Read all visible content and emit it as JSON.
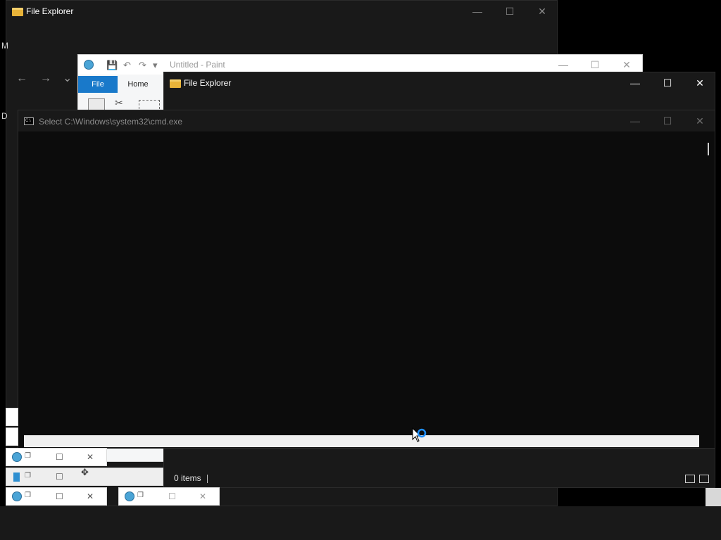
{
  "windows": {
    "file_explorer_back": {
      "title": "File Explorer",
      "controls": {
        "minimize": "—",
        "maximize": "☐",
        "close": "✕"
      },
      "nav": {
        "back": "←",
        "forward": "→",
        "recent": "⌄"
      }
    },
    "paint": {
      "title": "Untitled - Paint",
      "tabs": {
        "file": "File",
        "home": "Home"
      },
      "controls": {
        "minimize": "—",
        "maximize": "☐",
        "close": "✕"
      },
      "qat": {
        "save": "💾",
        "undo": "↶",
        "redo": "↷",
        "customize": "▾"
      }
    },
    "file_explorer_front": {
      "title": "File Explorer",
      "controls": {
        "minimize": "—",
        "maximize": "☐",
        "close": "✕"
      },
      "status": {
        "items": "0 items"
      }
    },
    "cmd": {
      "title": "Select C:\\Windows\\system32\\cmd.exe",
      "controls": {
        "minimize": "—",
        "maximize": "☐",
        "close": "✕"
      },
      "icon_text": "C:\\"
    }
  },
  "edge_fragments": {
    "left_m": "M",
    "left_d": "D"
  },
  "thumbnails": [
    {
      "name": "paint-thumb-1"
    },
    {
      "name": "notepad-thumb"
    },
    {
      "name": "paint-thumb-2"
    },
    {
      "name": "paint-thumb-3"
    }
  ],
  "colors": {
    "accent": "#1979ca",
    "cursor_ring": "#1e90ff"
  }
}
